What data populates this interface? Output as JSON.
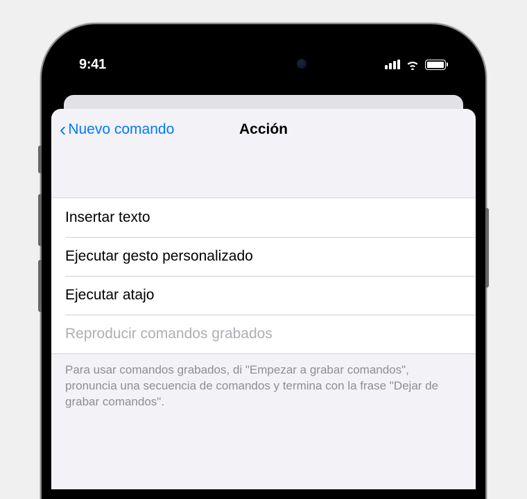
{
  "status_bar": {
    "time": "9:41"
  },
  "nav": {
    "back_label": "Nuevo comando",
    "title": "Acción"
  },
  "actions": {
    "insert_text": "Insertar texto",
    "custom_gesture": "Ejecutar gesto personalizado",
    "shortcut": "Ejecutar atajo",
    "recorded_commands": "Reproducir comandos grabados"
  },
  "footer": {
    "help_text": "Para usar comandos grabados, di \"Empezar a grabar comandos\", pronuncia una secuencia de comandos y termina con la frase \"Dejar de grabar comandos\"."
  }
}
